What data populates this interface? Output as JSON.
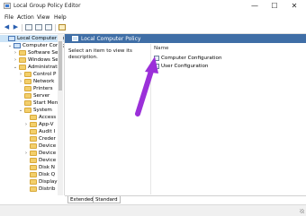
{
  "window": {
    "title": "Local Group Policy Editor",
    "minimize_glyph": "—",
    "maximize_glyph": "☐",
    "close_glyph": "✕"
  },
  "menu": [
    "File",
    "Action",
    "View",
    "Help"
  ],
  "toolbar": {
    "back_glyph": "◀",
    "forward_glyph": "▶",
    "icons": [
      "back-icon",
      "forward-icon",
      "show-hide-tree-icon",
      "properties-icon",
      "help-icon",
      "filter-icon"
    ]
  },
  "tree": {
    "items": [
      {
        "label": "Local Computer Polic",
        "level": 0,
        "expander": "",
        "icon": "computer-policy-icon",
        "selected": true
      },
      {
        "label": "Computer Config",
        "level": 1,
        "expander": "⌄",
        "icon": "computer-icon"
      },
      {
        "label": "Software Setti",
        "level": 2,
        "expander": "›",
        "icon": "folder-icon"
      },
      {
        "label": "Windows Sett",
        "level": 2,
        "expander": "›",
        "icon": "folder-icon"
      },
      {
        "label": "Administrativ",
        "level": 2,
        "expander": "⌄",
        "icon": "folder-icon"
      },
      {
        "label": "Control P",
        "level": 3,
        "expander": "›",
        "icon": "folder-icon"
      },
      {
        "label": "Network",
        "level": 3,
        "expander": "›",
        "icon": "folder-icon"
      },
      {
        "label": "Printers",
        "level": 3,
        "expander": "",
        "icon": "folder-icon"
      },
      {
        "label": "Server",
        "level": 3,
        "expander": "",
        "icon": "folder-icon"
      },
      {
        "label": "Start Men",
        "level": 3,
        "expander": "",
        "icon": "folder-icon"
      },
      {
        "label": "System",
        "level": 3,
        "expander": "⌄",
        "icon": "folder-icon"
      },
      {
        "label": "Access",
        "level": 4,
        "expander": "",
        "icon": "folder-icon"
      },
      {
        "label": "App-V",
        "level": 4,
        "expander": "›",
        "icon": "folder-icon"
      },
      {
        "label": "Audit I",
        "level": 4,
        "expander": "",
        "icon": "folder-icon"
      },
      {
        "label": "Creder",
        "level": 4,
        "expander": "",
        "icon": "folder-icon"
      },
      {
        "label": "Device",
        "level": 4,
        "expander": "",
        "icon": "folder-icon"
      },
      {
        "label": "Device",
        "level": 4,
        "expander": "›",
        "icon": "folder-icon"
      },
      {
        "label": "Device",
        "level": 4,
        "expander": "",
        "icon": "folder-icon"
      },
      {
        "label": "Disk N",
        "level": 4,
        "expander": "",
        "icon": "folder-icon"
      },
      {
        "label": "Disk Q",
        "level": 4,
        "expander": "",
        "icon": "folder-icon"
      },
      {
        "label": "Display",
        "level": 4,
        "expander": "",
        "icon": "folder-icon"
      },
      {
        "label": "Distrib",
        "level": 4,
        "expander": "",
        "icon": "folder-icon"
      }
    ]
  },
  "right_pane": {
    "header": "Local Computer Policy",
    "description": "Select an item to view its description.",
    "column_name": "Name",
    "items": [
      {
        "label": "Computer Configuration",
        "icon": "computer-config-icon"
      },
      {
        "label": "User Configuration",
        "icon": "user-config-icon"
      }
    ]
  },
  "tabs": [
    "Extended",
    "Standard"
  ],
  "annotation": {
    "color": "#9b30d9",
    "icon": "pointer-arrow"
  }
}
